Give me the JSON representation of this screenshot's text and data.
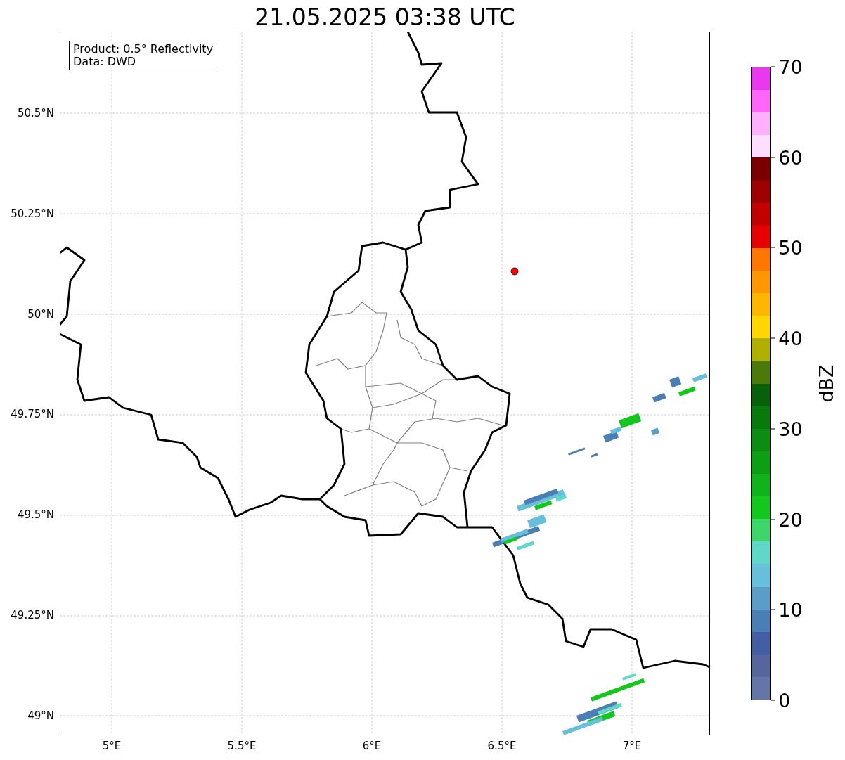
{
  "title": "21.05.2025 03:38 UTC",
  "info_box": {
    "lines": [
      "Product: 0.5° Reflectivity",
      "Data: DWD"
    ]
  },
  "map": {
    "x_ticks": [
      "5°E",
      "5.5°E",
      "6°E",
      "6.5°E",
      "7°E"
    ],
    "y_ticks": [
      "50.5°N",
      "50.25°N",
      "50°N",
      "49.75°N",
      "49.5°N",
      "49.25°N",
      "49°N"
    ]
  },
  "colorbar": {
    "label": "dBZ",
    "ticks": [
      "70",
      "60",
      "50",
      "40",
      "30",
      "20",
      "10",
      "0"
    ],
    "bins": [
      {
        "color": "#e839ee"
      },
      {
        "color": "#fd66f8"
      },
      {
        "color": "#feb0fe"
      },
      {
        "color": "#fedefe"
      },
      {
        "color": "#7a0000"
      },
      {
        "color": "#9e0000"
      },
      {
        "color": "#c20000"
      },
      {
        "color": "#e60000"
      },
      {
        "color": "#ff7700"
      },
      {
        "color": "#ff9800"
      },
      {
        "color": "#ffb600"
      },
      {
        "color": "#ffd600"
      },
      {
        "color": "#b0b000"
      },
      {
        "color": "#4b7a0a"
      },
      {
        "color": "#08600a"
      },
      {
        "color": "#087a0c"
      },
      {
        "color": "#0c8c12"
      },
      {
        "color": "#0e9e14"
      },
      {
        "color": "#10b41a"
      },
      {
        "color": "#12c81c"
      },
      {
        "color": "#3ed66a"
      },
      {
        "color": "#60d8c8"
      },
      {
        "color": "#66c0dc"
      },
      {
        "color": "#5a9ec8"
      },
      {
        "color": "#4a7eb4"
      },
      {
        "color": "#445ea4"
      },
      {
        "color": "#54669c"
      },
      {
        "color": "#6476a6"
      }
    ]
  }
}
